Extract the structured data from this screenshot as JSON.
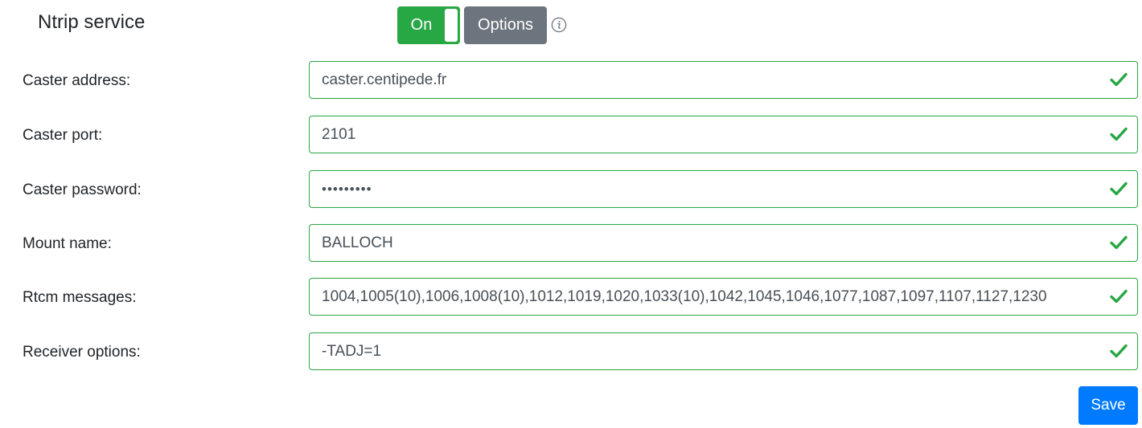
{
  "service": {
    "title": "Ntrip service",
    "toggle_label": "On",
    "toggle_state": "on",
    "options_label": "Options",
    "info_icon": "info-circle-icon"
  },
  "fields": [
    {
      "label": "Caster address:",
      "value": "caster.centipede.fr",
      "valid": true
    },
    {
      "label": "Caster port:",
      "value": "2101",
      "valid": true
    },
    {
      "label": "Caster password:",
      "value": "•••••••••",
      "valid": true
    },
    {
      "label": "Mount name:",
      "value": "BALLOCH",
      "valid": true
    },
    {
      "label": "Rtcm messages:",
      "value": "1004,1005(10),1006,1008(10),1012,1019,1020,1033(10),1042,1045,1046,1077,1087,1097,1107,1127,1230",
      "valid": true
    },
    {
      "label": "Receiver options:",
      "value": "-TADJ=1",
      "valid": true
    }
  ],
  "save_label": "Save",
  "colors": {
    "valid": "#28a745",
    "secondary": "#6c757d",
    "primary": "#007bff"
  }
}
